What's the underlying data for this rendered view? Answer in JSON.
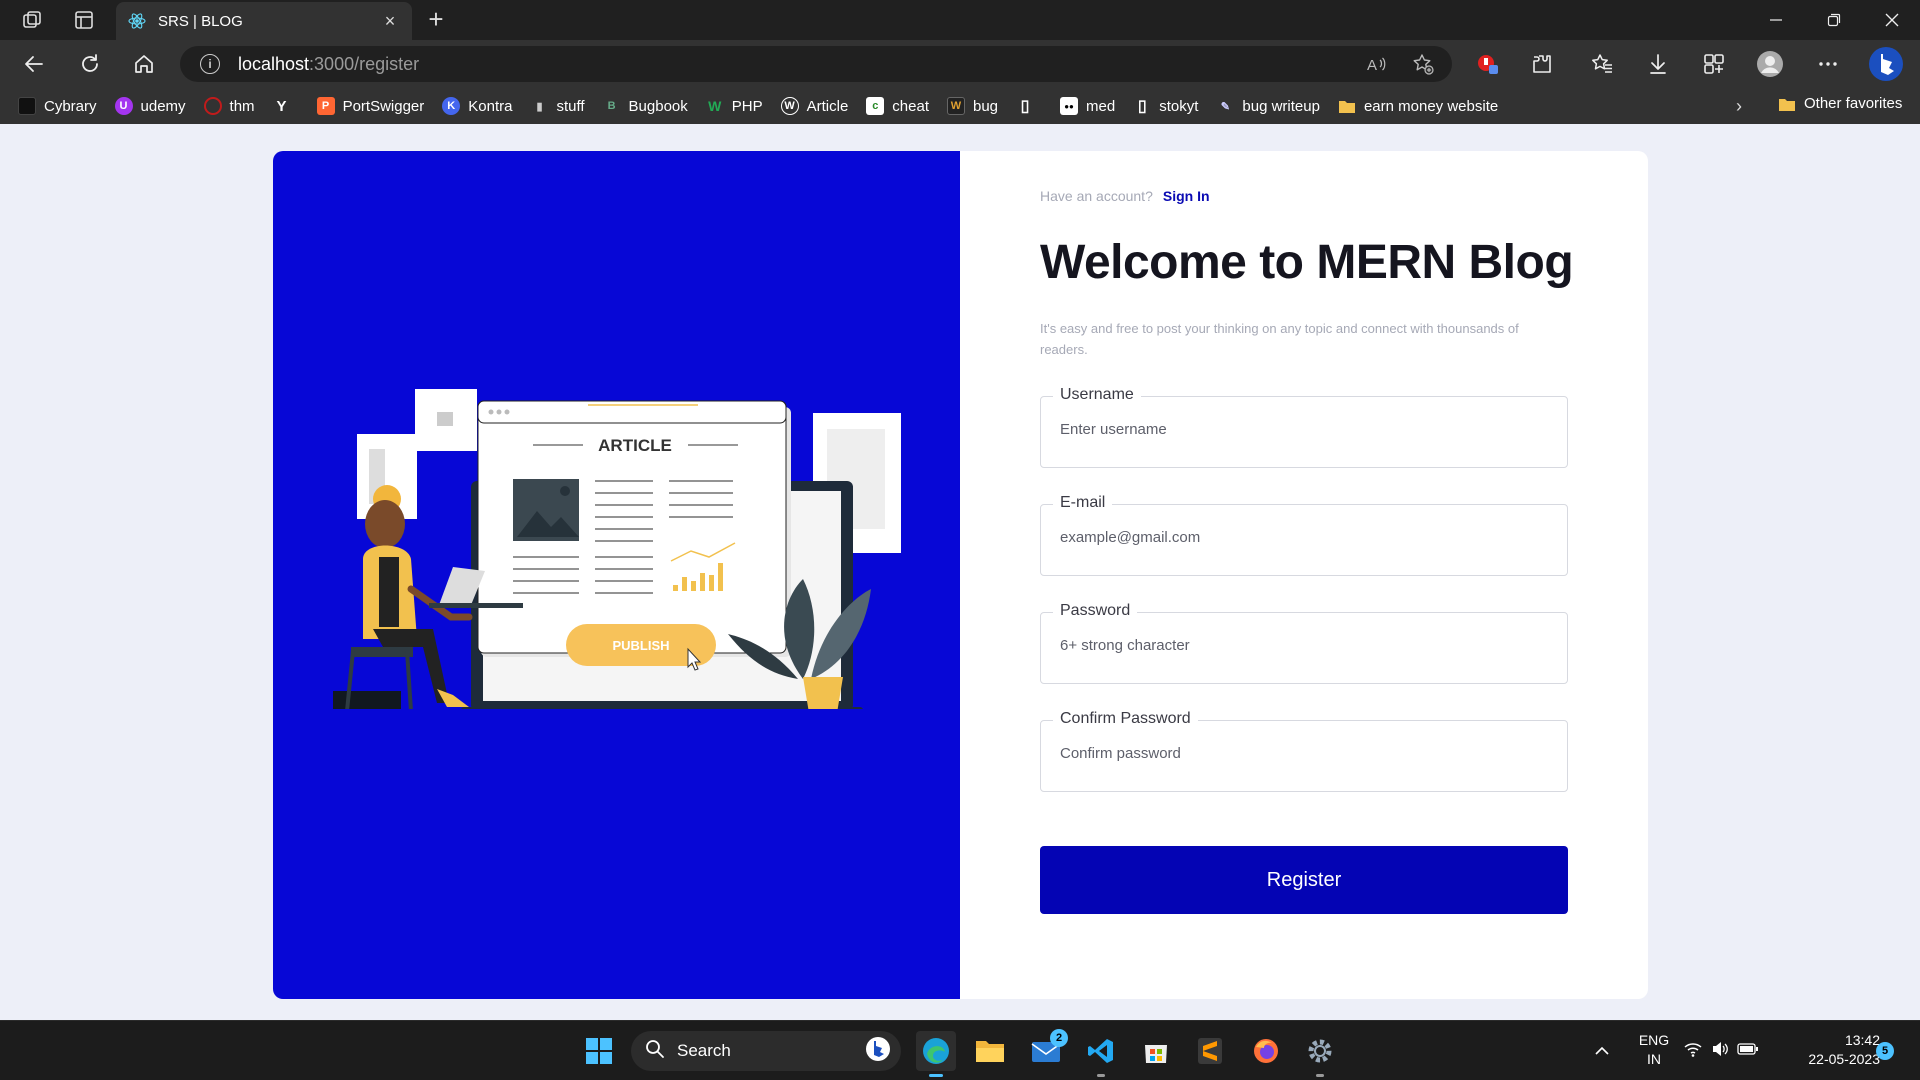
{
  "browser": {
    "tab_title": "SRS | BLOG",
    "tab_close": "×",
    "new_tab": "+",
    "url_host": "localhost",
    "url_path": ":3000/register",
    "info_icon": "i",
    "bookmarks": [
      {
        "label": "Cybrary",
        "icon_color": "#111111",
        "glyph": ""
      },
      {
        "label": "udemy",
        "icon_color": "#a435f0",
        "glyph": "U"
      },
      {
        "label": "thm",
        "icon_color": "#c11b1b",
        "glyph": ""
      },
      {
        "label": "",
        "icon_color": "#ffffff",
        "glyph": "Y"
      },
      {
        "label": "PortSwigger",
        "icon_color": "#ff6633",
        "glyph": "P"
      },
      {
        "label": "Kontra",
        "icon_color": "#4466ee",
        "glyph": "K"
      },
      {
        "label": "stuff",
        "icon_color": "#cccccc",
        "glyph": "▮"
      },
      {
        "label": "Bugbook",
        "icon_color": "#66aa88",
        "glyph": "B"
      },
      {
        "label": "PHP",
        "icon_color": "#22aa55",
        "glyph": "W"
      },
      {
        "label": "Article",
        "icon_color": "#ffffff",
        "glyph": "W"
      },
      {
        "label": "cheat",
        "icon_color": "#ffffff",
        "glyph": "c"
      },
      {
        "label": "bug",
        "icon_color": "#222222",
        "glyph": "W"
      },
      {
        "label": "",
        "icon_color": "#ffffff",
        "glyph": "▯"
      },
      {
        "label": "med",
        "icon_color": "#ffffff",
        "glyph": "●●"
      },
      {
        "label": "stokyt",
        "icon_color": "#ffffff",
        "glyph": "▯"
      },
      {
        "label": "bug writeup",
        "icon_color": "#ccccff",
        "glyph": "✎"
      },
      {
        "label": "earn money website",
        "icon_color": "#f2c14e",
        "glyph": ""
      }
    ],
    "bookmarks_more": "›",
    "other_favorites": "Other favorites"
  },
  "page": {
    "have_account": "Have an account?",
    "sign_in": "Sign In",
    "heading": "Welcome to MERN Blog",
    "tagline": "It's easy and free to post your thinking on any topic and connect with thounsands of readers.",
    "illustration": {
      "article_label": "ARTICLE",
      "publish_label": "PUBLISH"
    },
    "fields": {
      "username": {
        "label": "Username",
        "placeholder": "Enter username",
        "value": ""
      },
      "email": {
        "label": "E-mail",
        "placeholder": "example@gmail.com",
        "value": ""
      },
      "password": {
        "label": "Password",
        "placeholder": "6+ strong character",
        "value": ""
      },
      "confirm": {
        "label": "Confirm Password",
        "placeholder": "Confirm password",
        "value": ""
      }
    },
    "register_button": "Register"
  },
  "colors": {
    "brand_blue": "#0707d6",
    "button_blue": "#0404b4",
    "page_bg": "#edeff8"
  },
  "taskbar": {
    "search_label": "Search",
    "mail_badge": "2",
    "lang_line1": "ENG",
    "lang_line2": "IN",
    "time": "13:42",
    "date": "22-05-2023",
    "notification_count": "5"
  }
}
